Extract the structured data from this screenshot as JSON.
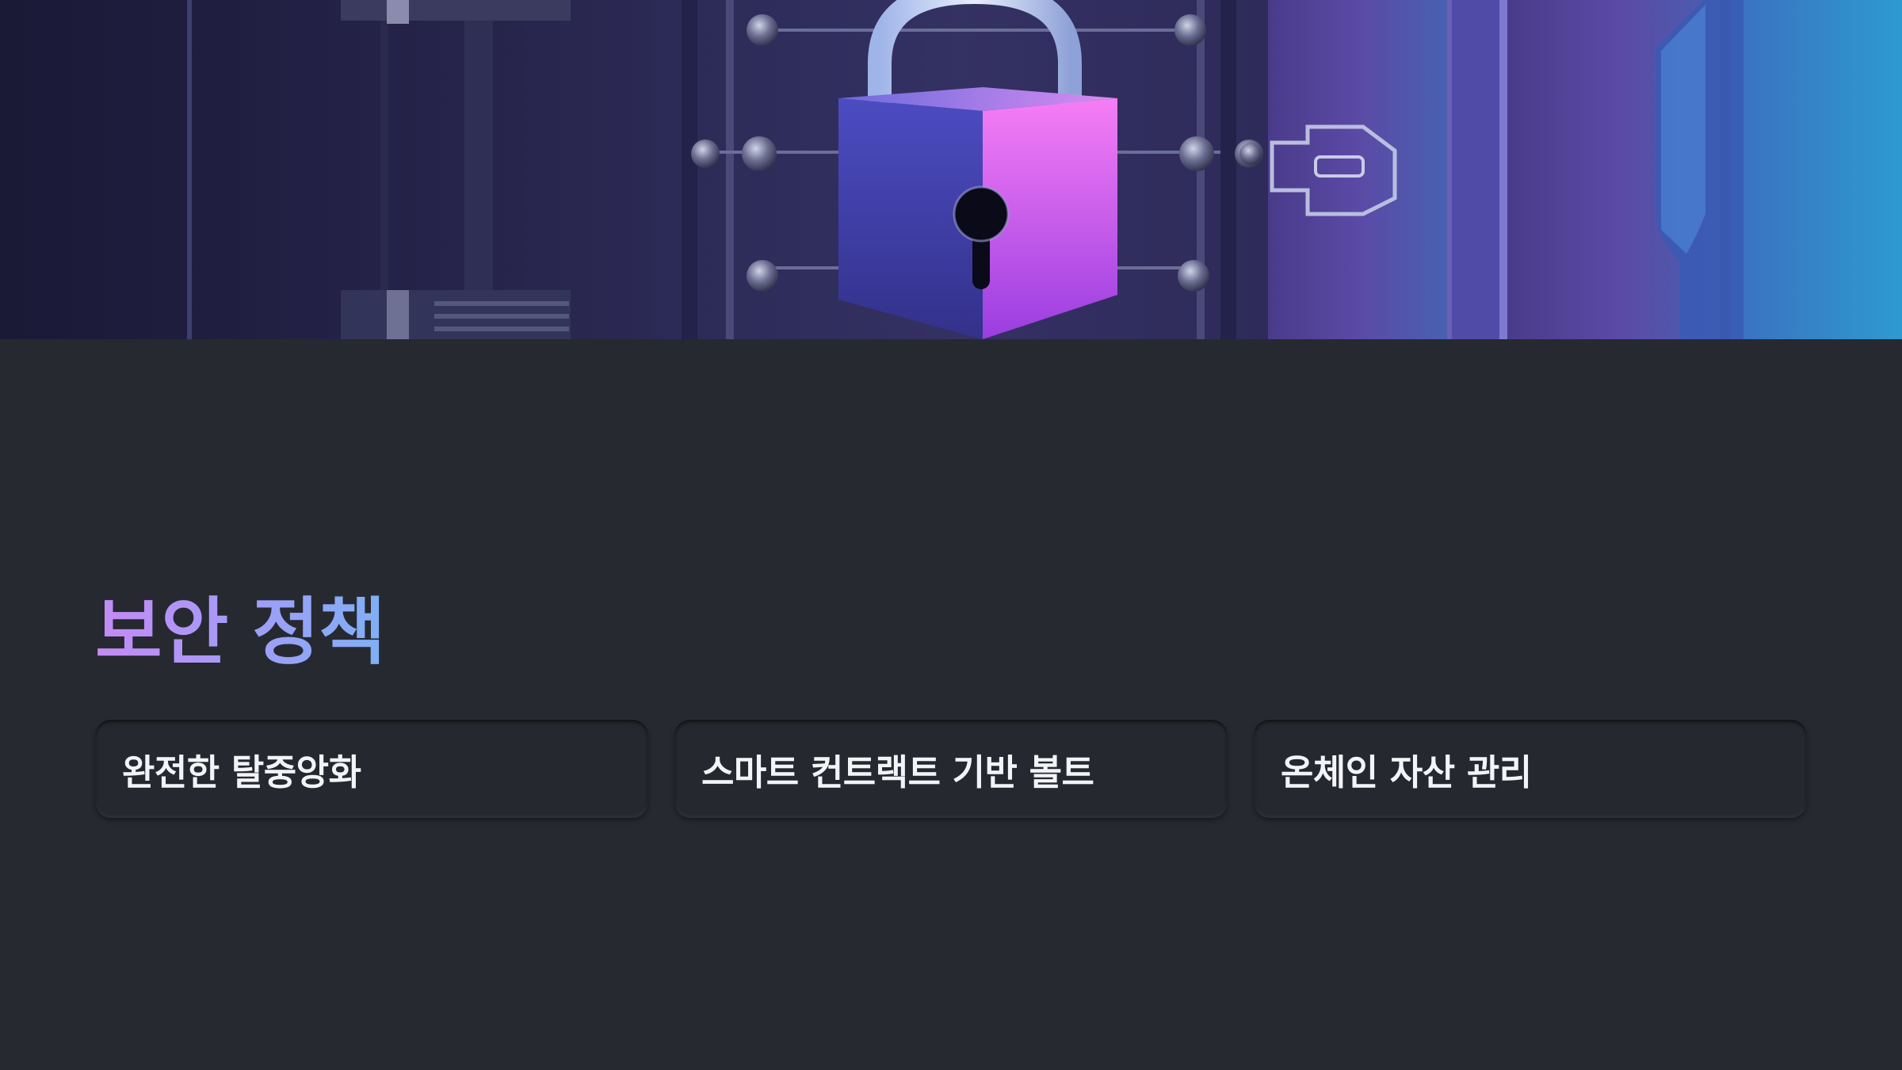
{
  "slide": {
    "hero_image": "padlock-on-vault-door",
    "title": "보안 정책",
    "cards": [
      {
        "label": "완전한 탈중앙화"
      },
      {
        "label": "스마트 컨트랙트 기반 볼트"
      },
      {
        "label": "온체인 자산 관리"
      }
    ]
  },
  "colors": {
    "background": "#262930",
    "card": "#25282e",
    "card_text": "#f3f4f7",
    "title_gradient_start": "#c58af5",
    "title_gradient_end": "#7fb0f6",
    "padlock_body_left": "#3e3aa8",
    "padlock_body_right": "#e45cf0"
  }
}
